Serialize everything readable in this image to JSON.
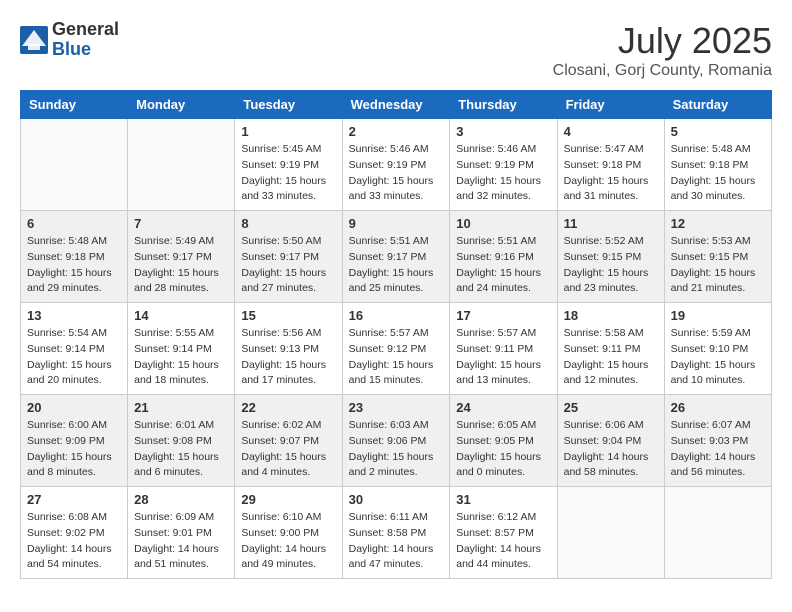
{
  "logo": {
    "general": "General",
    "blue": "Blue"
  },
  "title": "July 2025",
  "location": "Closani, Gorj County, Romania",
  "days_header": [
    "Sunday",
    "Monday",
    "Tuesday",
    "Wednesday",
    "Thursday",
    "Friday",
    "Saturday"
  ],
  "weeks": [
    [
      {
        "day": "",
        "info": ""
      },
      {
        "day": "",
        "info": ""
      },
      {
        "day": "1",
        "info": "Sunrise: 5:45 AM\nSunset: 9:19 PM\nDaylight: 15 hours\nand 33 minutes."
      },
      {
        "day": "2",
        "info": "Sunrise: 5:46 AM\nSunset: 9:19 PM\nDaylight: 15 hours\nand 33 minutes."
      },
      {
        "day": "3",
        "info": "Sunrise: 5:46 AM\nSunset: 9:19 PM\nDaylight: 15 hours\nand 32 minutes."
      },
      {
        "day": "4",
        "info": "Sunrise: 5:47 AM\nSunset: 9:18 PM\nDaylight: 15 hours\nand 31 minutes."
      },
      {
        "day": "5",
        "info": "Sunrise: 5:48 AM\nSunset: 9:18 PM\nDaylight: 15 hours\nand 30 minutes."
      }
    ],
    [
      {
        "day": "6",
        "info": "Sunrise: 5:48 AM\nSunset: 9:18 PM\nDaylight: 15 hours\nand 29 minutes."
      },
      {
        "day": "7",
        "info": "Sunrise: 5:49 AM\nSunset: 9:17 PM\nDaylight: 15 hours\nand 28 minutes."
      },
      {
        "day": "8",
        "info": "Sunrise: 5:50 AM\nSunset: 9:17 PM\nDaylight: 15 hours\nand 27 minutes."
      },
      {
        "day": "9",
        "info": "Sunrise: 5:51 AM\nSunset: 9:17 PM\nDaylight: 15 hours\nand 25 minutes."
      },
      {
        "day": "10",
        "info": "Sunrise: 5:51 AM\nSunset: 9:16 PM\nDaylight: 15 hours\nand 24 minutes."
      },
      {
        "day": "11",
        "info": "Sunrise: 5:52 AM\nSunset: 9:15 PM\nDaylight: 15 hours\nand 23 minutes."
      },
      {
        "day": "12",
        "info": "Sunrise: 5:53 AM\nSunset: 9:15 PM\nDaylight: 15 hours\nand 21 minutes."
      }
    ],
    [
      {
        "day": "13",
        "info": "Sunrise: 5:54 AM\nSunset: 9:14 PM\nDaylight: 15 hours\nand 20 minutes."
      },
      {
        "day": "14",
        "info": "Sunrise: 5:55 AM\nSunset: 9:14 PM\nDaylight: 15 hours\nand 18 minutes."
      },
      {
        "day": "15",
        "info": "Sunrise: 5:56 AM\nSunset: 9:13 PM\nDaylight: 15 hours\nand 17 minutes."
      },
      {
        "day": "16",
        "info": "Sunrise: 5:57 AM\nSunset: 9:12 PM\nDaylight: 15 hours\nand 15 minutes."
      },
      {
        "day": "17",
        "info": "Sunrise: 5:57 AM\nSunset: 9:11 PM\nDaylight: 15 hours\nand 13 minutes."
      },
      {
        "day": "18",
        "info": "Sunrise: 5:58 AM\nSunset: 9:11 PM\nDaylight: 15 hours\nand 12 minutes."
      },
      {
        "day": "19",
        "info": "Sunrise: 5:59 AM\nSunset: 9:10 PM\nDaylight: 15 hours\nand 10 minutes."
      }
    ],
    [
      {
        "day": "20",
        "info": "Sunrise: 6:00 AM\nSunset: 9:09 PM\nDaylight: 15 hours\nand 8 minutes."
      },
      {
        "day": "21",
        "info": "Sunrise: 6:01 AM\nSunset: 9:08 PM\nDaylight: 15 hours\nand 6 minutes."
      },
      {
        "day": "22",
        "info": "Sunrise: 6:02 AM\nSunset: 9:07 PM\nDaylight: 15 hours\nand 4 minutes."
      },
      {
        "day": "23",
        "info": "Sunrise: 6:03 AM\nSunset: 9:06 PM\nDaylight: 15 hours\nand 2 minutes."
      },
      {
        "day": "24",
        "info": "Sunrise: 6:05 AM\nSunset: 9:05 PM\nDaylight: 15 hours\nand 0 minutes."
      },
      {
        "day": "25",
        "info": "Sunrise: 6:06 AM\nSunset: 9:04 PM\nDaylight: 14 hours\nand 58 minutes."
      },
      {
        "day": "26",
        "info": "Sunrise: 6:07 AM\nSunset: 9:03 PM\nDaylight: 14 hours\nand 56 minutes."
      }
    ],
    [
      {
        "day": "27",
        "info": "Sunrise: 6:08 AM\nSunset: 9:02 PM\nDaylight: 14 hours\nand 54 minutes."
      },
      {
        "day": "28",
        "info": "Sunrise: 6:09 AM\nSunset: 9:01 PM\nDaylight: 14 hours\nand 51 minutes."
      },
      {
        "day": "29",
        "info": "Sunrise: 6:10 AM\nSunset: 9:00 PM\nDaylight: 14 hours\nand 49 minutes."
      },
      {
        "day": "30",
        "info": "Sunrise: 6:11 AM\nSunset: 8:58 PM\nDaylight: 14 hours\nand 47 minutes."
      },
      {
        "day": "31",
        "info": "Sunrise: 6:12 AM\nSunset: 8:57 PM\nDaylight: 14 hours\nand 44 minutes."
      },
      {
        "day": "",
        "info": ""
      },
      {
        "day": "",
        "info": ""
      }
    ]
  ]
}
